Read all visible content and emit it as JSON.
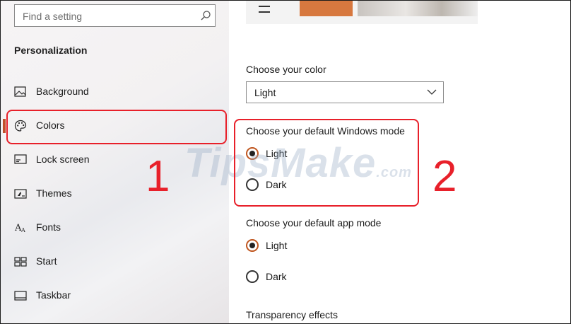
{
  "search": {
    "placeholder": "Find a setting"
  },
  "sidebar": {
    "title": "Personalization",
    "items": [
      {
        "label": "Background",
        "icon": "image-icon"
      },
      {
        "label": "Colors",
        "icon": "palette-icon",
        "selected": true
      },
      {
        "label": "Lock screen",
        "icon": "lock-screen-icon"
      },
      {
        "label": "Themes",
        "icon": "themes-icon"
      },
      {
        "label": "Fonts",
        "icon": "fonts-icon"
      },
      {
        "label": "Start",
        "icon": "start-icon"
      },
      {
        "label": "Taskbar",
        "icon": "taskbar-icon"
      }
    ]
  },
  "main": {
    "color_label": "Choose your color",
    "color_value": "Light",
    "windows_mode": {
      "label": "Choose your default Windows mode",
      "options": [
        {
          "label": "Light",
          "selected": true
        },
        {
          "label": "Dark",
          "selected": false
        }
      ]
    },
    "app_mode": {
      "label": "Choose your default app mode",
      "options": [
        {
          "label": "Light",
          "selected": true
        },
        {
          "label": "Dark",
          "selected": false
        }
      ]
    },
    "transparency_label": "Transparency effects"
  },
  "annotations": {
    "step1": "1",
    "step2": "2",
    "watermark_main": "TipsMake",
    "watermark_suffix": ".com"
  },
  "colors": {
    "accent": "#c0561f",
    "highlight": "#e8202a"
  }
}
